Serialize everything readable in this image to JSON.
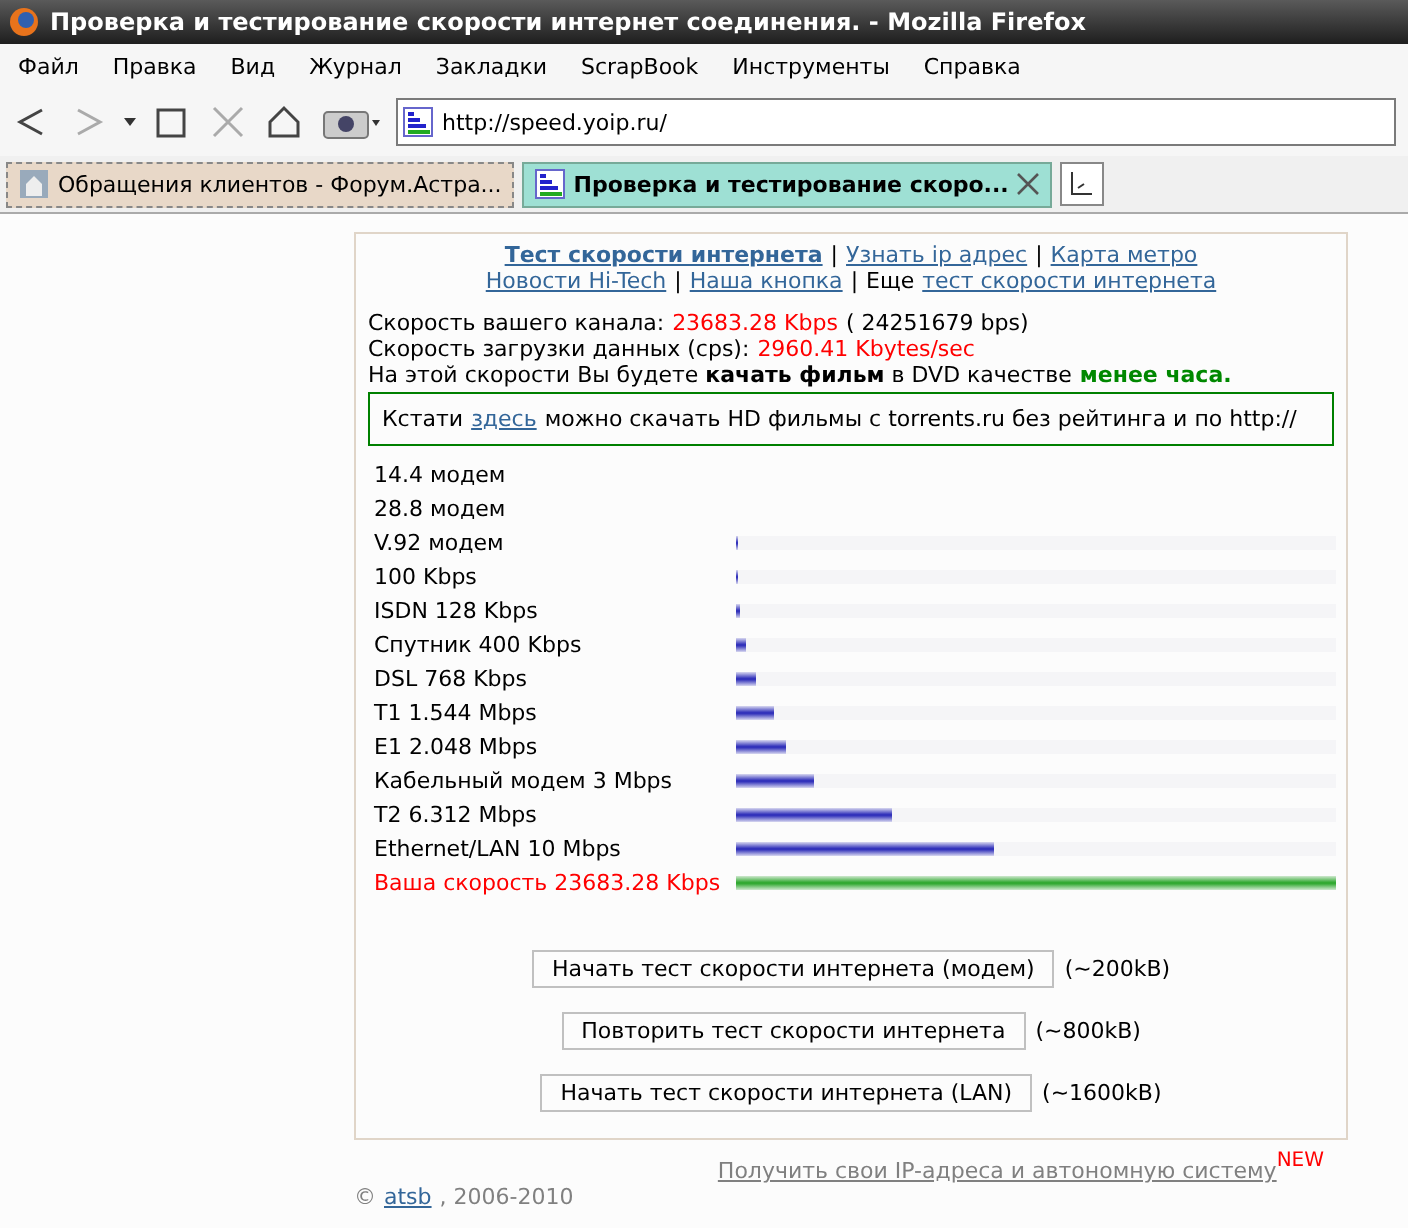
{
  "window": {
    "title": "Проверка и тестирование скорости интернет соединения. - Mozilla Firefox"
  },
  "menu": [
    "Файл",
    "Правка",
    "Вид",
    "Журнал",
    "Закладки",
    "ScrapBook",
    "Инструменты",
    "Справка"
  ],
  "address": {
    "value": "http://speed.yoip.ru/"
  },
  "tabs": [
    {
      "label": "Обращения клиентов - Форум.Астра...",
      "selected": false
    },
    {
      "label": "Проверка и тестирование скоро...",
      "selected": true
    }
  ],
  "nav": {
    "line_1": [
      {
        "text": "Тест скорости интернета",
        "kind": "strong"
      },
      {
        "text": "|",
        "kind": "sep"
      },
      {
        "text": "Узнать ip адрес",
        "kind": "link"
      },
      {
        "text": "|",
        "kind": "sep"
      },
      {
        "text": "Карта метро",
        "kind": "link"
      }
    ],
    "line_2": [
      {
        "text": "Новости Hi-Tech",
        "kind": "link"
      },
      {
        "text": "|",
        "kind": "sep"
      },
      {
        "text": "Наша кнопка",
        "kind": "link"
      },
      {
        "text": "|",
        "kind": "sep"
      },
      {
        "text": "Еще",
        "kind": "plain"
      },
      {
        "text": "тест скорости интернета",
        "kind": "link"
      }
    ]
  },
  "results": {
    "channel_label": "Скорость вашего канала:",
    "channel_value": "23683.28 Kbps",
    "channel_bps": "( 24251679 bps)",
    "download_label": "Скорость загрузки данных (cps):",
    "download_value": "2960.41 Kbytes/sec",
    "verdict": "На этой скорости Вы будете **качать фильм** в DVD качестве",
    "verdict_time": "менее часа."
  },
  "notice": {
    "before": "Кстати",
    "link": "здесь",
    "after": "можно скачать HD фильмы с torrents.ru без рейтинга и по http://"
  },
  "speeds": [
    {
      "label": "14.4 модем",
      "own": false
    },
    {
      "label": "28.8 модем",
      "own": false
    },
    {
      "label": "V.92 модем",
      "level": 0.003,
      "own": false
    },
    {
      "label": "100 Kbps",
      "level": 0.003,
      "own": false
    },
    {
      "label": "ISDN 128 Kbps",
      "level": 0.007,
      "own": false
    },
    {
      "label": "Спутник 400 Kbps",
      "level": 0.017,
      "own": false
    },
    {
      "label": "DSL 768 Kbps",
      "level": 0.033,
      "own": false
    },
    {
      "label": "T1 1.544 Mbps",
      "level": 0.063,
      "own": false
    },
    {
      "label": "E1 2.048 Mbps",
      "level": 0.083,
      "own": false
    },
    {
      "label": "Кабельный модем 3 Mbps",
      "level": 0.13,
      "own": false
    },
    {
      "label": "T2 6.312 Mbps",
      "level": 0.26,
      "own": false
    },
    {
      "label": "Ethernet/LAN 10 Mbps",
      "level": 0.43,
      "own": false
    },
    {
      "label": "Ваша скорость 23683.28 Kbps",
      "level": 1,
      "own": true
    }
  ],
  "tests": [
    {
      "button": "Начать тест скорости интернета (модем)",
      "size": "(~200kB)"
    },
    {
      "button": "Повторить тест скорости интернета",
      "size": "(~800kB)"
    },
    {
      "button": "Начать тест скорости интернета (LAN)",
      "size": "(~1600kB)"
    }
  ],
  "footer": {
    "ip_link": "Получить свои IP-адреса и автономную систему",
    "new_badge": "NEW",
    "copyright": "©",
    "author": "atsb",
    "years": ", 2006-2010"
  }
}
